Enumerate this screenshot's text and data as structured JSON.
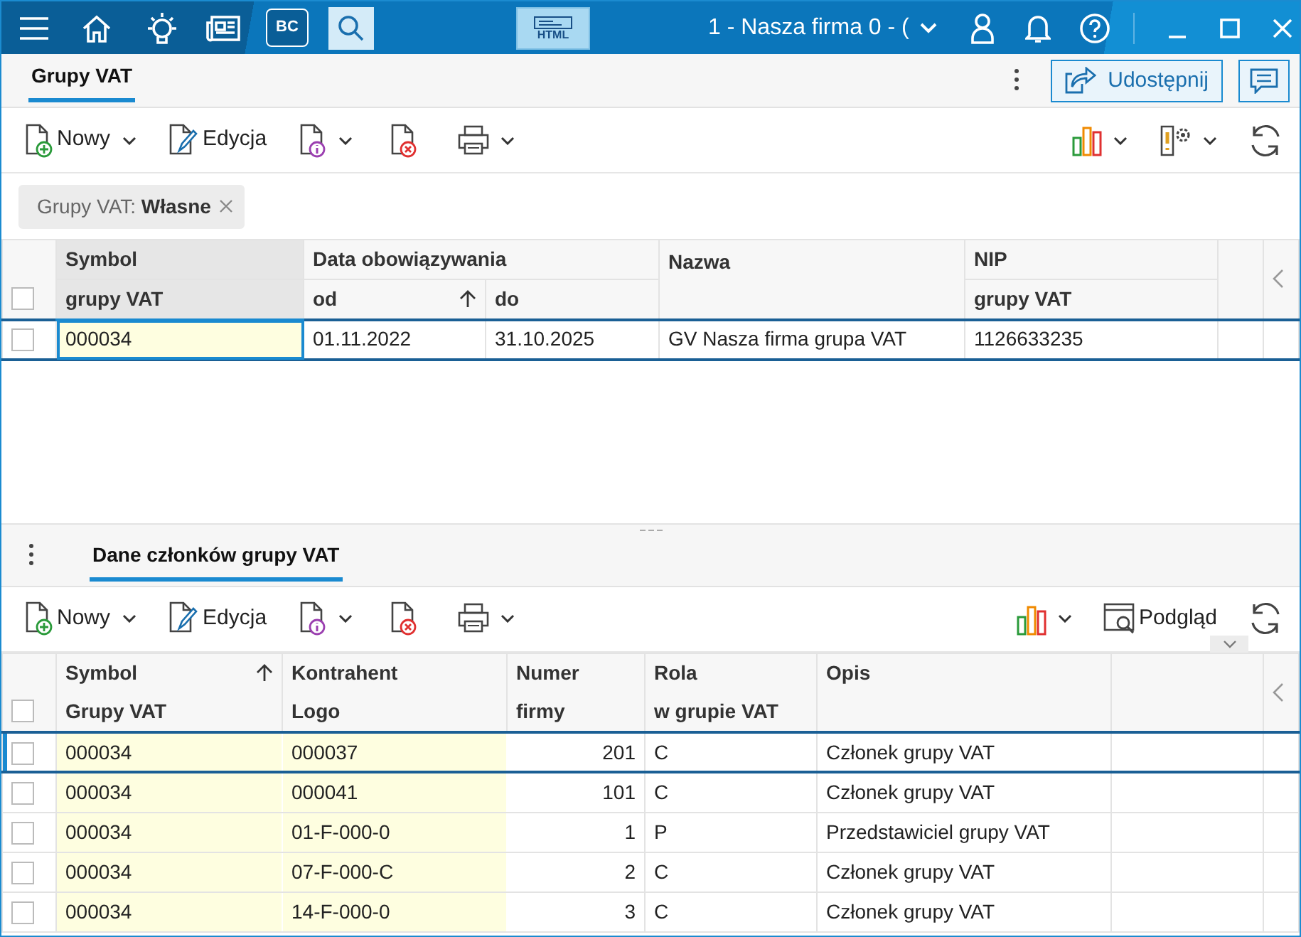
{
  "title_bar": {
    "bc_label": "BC",
    "html_label": "HTML",
    "company": "1 - Nasza firma 0 - ("
  },
  "tabs": [
    {
      "label": "Grupy VAT",
      "selected": true
    }
  ],
  "share_button": {
    "label": "Udostępnij"
  },
  "toolbar": {
    "new_label": "Nowy",
    "edit_label": "Edycja"
  },
  "filter_chip": {
    "label": "Grupy VAT:",
    "value": "Własne"
  },
  "top_grid": {
    "columns": [
      {
        "kind": "single",
        "line1": "Symbol",
        "line2": "grupy VAT",
        "highlighted": true,
        "sorted": false
      },
      {
        "kind": "group",
        "label": "Data obowiązywania",
        "colspan": 2,
        "subcolumns": [
          {
            "label": "od",
            "sorted": true
          },
          {
            "label": "do",
            "sorted": false
          }
        ]
      },
      {
        "kind": "single",
        "line1": "Nazwa",
        "sorted": false
      },
      {
        "kind": "single",
        "line1": "NIP",
        "line2": "grupy VAT",
        "sorted": false
      }
    ],
    "select_all_checked": false,
    "rows": [
      {
        "selected": true,
        "checked": false,
        "cells": [
          "000034",
          "01.11.2022",
          "31.10.2025",
          "GV Nasza firma grupa VAT",
          "1126633235"
        ]
      }
    ]
  },
  "bottom_tabs": [
    {
      "label": "Dane członków grupy VAT",
      "selected": true
    }
  ],
  "bottom_toolbar": {
    "new_label": "Nowy",
    "edit_label": "Edycja",
    "preview_label": "Podgląd",
    "expanded": false
  },
  "bottom_grid": {
    "columns": [
      {
        "line1": "Symbol",
        "line2": "Grupy VAT",
        "sorted": true,
        "highlighted": true,
        "numeric": false
      },
      {
        "line1": "Kontrahent",
        "line2": "Logo",
        "sorted": false,
        "highlighted": true,
        "numeric": false
      },
      {
        "line1": "Numer",
        "line2": "firmy",
        "sorted": false,
        "highlighted": false,
        "numeric": true
      },
      {
        "line1": "Rola",
        "line2": "w grupie VAT",
        "sorted": false,
        "highlighted": false,
        "numeric": false
      },
      {
        "line1": "Opis",
        "sorted": false,
        "highlighted": false,
        "numeric": false
      }
    ],
    "select_all_checked": false,
    "rows": [
      {
        "selected": true,
        "checked": false,
        "cells": [
          "000034",
          "000037",
          "201",
          "C",
          "Członek grupy VAT"
        ]
      },
      {
        "selected": false,
        "checked": false,
        "cells": [
          "000034",
          "000041",
          "101",
          "C",
          "Członek grupy VAT"
        ]
      },
      {
        "selected": false,
        "checked": false,
        "cells": [
          "000034",
          "01-F-000-0",
          "1",
          "P",
          "Przedstawiciel grupy VAT"
        ]
      },
      {
        "selected": false,
        "checked": false,
        "cells": [
          "000034",
          "07-F-000-C",
          "2",
          "C",
          "Członek grupy VAT"
        ]
      },
      {
        "selected": false,
        "checked": false,
        "cells": [
          "000034",
          "14-F-000-0",
          "3",
          "C",
          "Członek grupy VAT"
        ]
      }
    ]
  }
}
